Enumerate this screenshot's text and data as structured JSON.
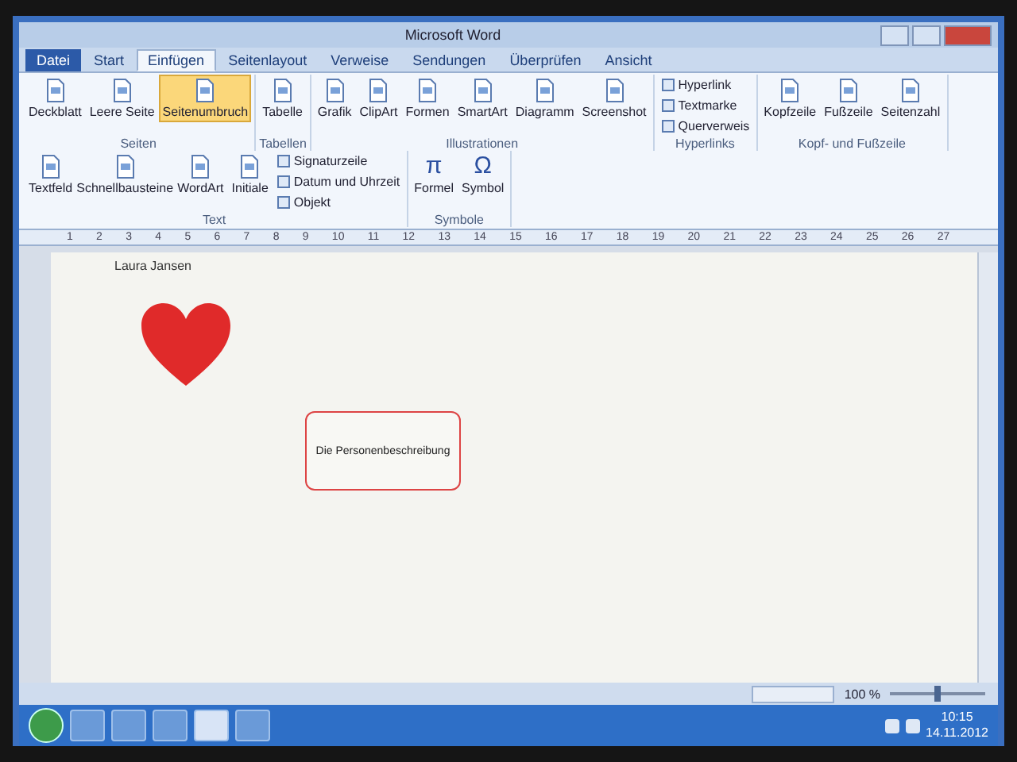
{
  "window": {
    "title": "Microsoft Word"
  },
  "tabs": [
    {
      "label": "Datei",
      "selected": false,
      "kind": "file"
    },
    {
      "label": "Start",
      "selected": false,
      "kind": "normal"
    },
    {
      "label": "Einfügen",
      "selected": true,
      "kind": "normal"
    },
    {
      "label": "Seitenlayout",
      "selected": false,
      "kind": "normal"
    },
    {
      "label": "Verweise",
      "selected": false,
      "kind": "normal"
    },
    {
      "label": "Sendungen",
      "selected": false,
      "kind": "normal"
    },
    {
      "label": "Überprüfen",
      "selected": false,
      "kind": "normal"
    },
    {
      "label": "Ansicht",
      "selected": false,
      "kind": "normal"
    }
  ],
  "ribbon_groups": [
    {
      "label": "Seiten",
      "buttons": [
        {
          "label": "Deckblatt",
          "kind": "large",
          "selected": false
        },
        {
          "label": "Leere Seite",
          "kind": "large",
          "selected": false
        },
        {
          "label": "Seitenumbruch",
          "kind": "large",
          "selected": true
        }
      ]
    },
    {
      "label": "Tabellen",
      "buttons": [
        {
          "label": "Tabelle",
          "kind": "large",
          "selected": false
        }
      ]
    },
    {
      "label": "Illustrationen",
      "buttons": [
        {
          "label": "Grafik",
          "kind": "large",
          "selected": false
        },
        {
          "label": "ClipArt",
          "kind": "large",
          "selected": false
        },
        {
          "label": "Formen",
          "kind": "large",
          "selected": false
        },
        {
          "label": "SmartArt",
          "kind": "large",
          "selected": false
        },
        {
          "label": "Diagramm",
          "kind": "large",
          "selected": false
        },
        {
          "label": "Screenshot",
          "kind": "large",
          "selected": false
        }
      ]
    },
    {
      "label": "Hyperlinks",
      "buttons": [
        {
          "label": "Hyperlink",
          "kind": "small",
          "selected": false
        },
        {
          "label": "Textmarke",
          "kind": "small",
          "selected": false
        },
        {
          "label": "Querverweis",
          "kind": "small",
          "selected": false
        }
      ]
    },
    {
      "label": "Kopf- und Fußzeile",
      "buttons": [
        {
          "label": "Kopfzeile",
          "kind": "large",
          "selected": false
        },
        {
          "label": "Fußzeile",
          "kind": "large",
          "selected": false
        },
        {
          "label": "Seitenzahl",
          "kind": "large",
          "selected": false
        }
      ]
    },
    {
      "label": "Text",
      "buttons": [
        {
          "label": "Textfeld",
          "kind": "large",
          "selected": false
        },
        {
          "label": "Schnellbausteine",
          "kind": "large",
          "selected": false
        },
        {
          "label": "WordArt",
          "kind": "large",
          "selected": false
        },
        {
          "label": "Initiale",
          "kind": "large",
          "selected": false
        },
        {
          "label": "Signaturzeile",
          "kind": "small",
          "selected": false
        },
        {
          "label": "Datum und Uhrzeit",
          "kind": "small",
          "selected": false
        },
        {
          "label": "Objekt",
          "kind": "small",
          "selected": false
        }
      ]
    },
    {
      "label": "Symbole",
      "buttons": [
        {
          "label": "Formel",
          "kind": "glyph",
          "icon": "π",
          "selected": false
        },
        {
          "label": "Symbol",
          "kind": "glyph",
          "icon": "Ω",
          "selected": false
        }
      ]
    }
  ],
  "ruler": [
    "1",
    "2",
    "3",
    "4",
    "5",
    "6",
    "7",
    "8",
    "9",
    "10",
    "11",
    "12",
    "13",
    "14",
    "15",
    "16",
    "17",
    "18",
    "19",
    "20",
    "21",
    "22",
    "23",
    "24",
    "25",
    "26",
    "27"
  ],
  "document": {
    "header": "Laura Jansen",
    "scroll_text": "Die Personenbeschreibung"
  },
  "status_bar": {
    "zoom": "100 %",
    "zoom_slider": {
      "level": 0.5
    }
  },
  "taskbar": {
    "time": "10:15",
    "date": "14.11.2012"
  }
}
